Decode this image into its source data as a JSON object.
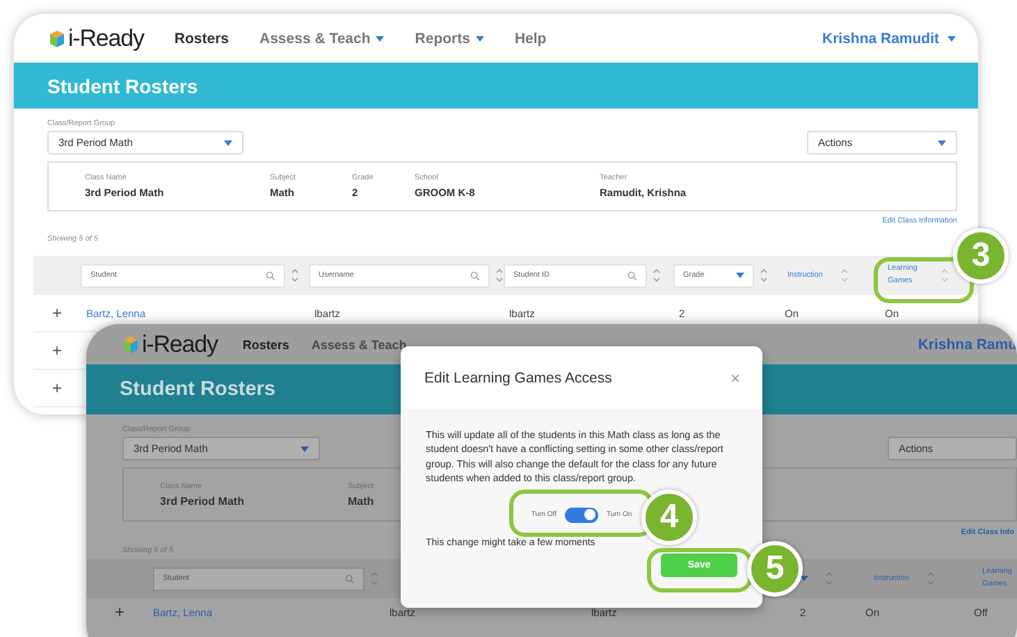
{
  "back": {
    "logo": "i-Ready",
    "nav": [
      {
        "label": "Rosters",
        "selected": true,
        "dropdown": false
      },
      {
        "label": "Assess & Teach",
        "selected": false,
        "dropdown": true
      },
      {
        "label": "Reports",
        "selected": false,
        "dropdown": true
      },
      {
        "label": "Help",
        "selected": false,
        "dropdown": false
      }
    ],
    "user": "Krishna Ramudit",
    "title": "Student Rosters",
    "group_label": "Class/Report Group",
    "group_value": "3rd Period Math",
    "actions": "Actions",
    "class_info": [
      {
        "label": "Class Name",
        "value": "3rd Period Math"
      },
      {
        "label": "Subject",
        "value": "Math"
      },
      {
        "label": "Grade",
        "value": "2"
      },
      {
        "label": "School",
        "value": "GROOM K-8"
      },
      {
        "label": "Teacher",
        "value": "Ramudit, Krishna"
      }
    ],
    "edit_link": "Edit Class Information",
    "showing": "Showing 5 of 5",
    "columns": [
      {
        "kind": "search",
        "placeholder": "Student"
      },
      {
        "kind": "search",
        "placeholder": "Username"
      },
      {
        "kind": "search",
        "placeholder": "Student ID"
      },
      {
        "kind": "select",
        "placeholder": "Grade"
      },
      {
        "kind": "sort",
        "label": "Instruction"
      },
      {
        "kind": "sort",
        "label": "Learning Games"
      }
    ],
    "rows": [
      {
        "expand": "+",
        "cells": [
          "Bartz, Lenna",
          "lbartz",
          "lbartz",
          "2",
          "On",
          "On"
        ]
      },
      {
        "expand": "+",
        "cells": []
      },
      {
        "expand": "+",
        "cells": []
      }
    ]
  },
  "front": {
    "logo": "i-Ready",
    "nav": [
      {
        "label": "Rosters",
        "selected": true
      },
      {
        "label": "Assess & Teach",
        "selected": false
      }
    ],
    "user": "Krishna Ramu",
    "title": "Student Rosters",
    "group_label": "Class/Report Group",
    "group_value": "3rd Period Math",
    "actions": "Actions",
    "class_info": [
      {
        "label": "Class Name",
        "value": "3rd Period Math"
      },
      {
        "label": "Subject",
        "value": "Math"
      }
    ],
    "edit_link": "Edit Class Info",
    "showing": "Showing 5 of 5",
    "student_placeholder": "Student",
    "instruction": "Instruction",
    "learning_games": "Learning Games",
    "row": {
      "expand": "+",
      "cells": [
        "Bartz, Lenna",
        "lbartz",
        "lbartz",
        "2",
        "On",
        "Off"
      ]
    }
  },
  "modal": {
    "title": "Edit Learning Games Access",
    "close": "×",
    "body": "This will update all of the students in this Math class as long as the student doesn't have a conflicting setting in some other class/report group. This will also change the default for the class for any future students when added to this class/report group.",
    "toggle": {
      "off_label": "Turn Off",
      "on_label": "Turn On",
      "on": true
    },
    "note": "This change might take a few moments",
    "save": "Save"
  },
  "callouts": [
    {
      "number": "3"
    },
    {
      "number": "4"
    },
    {
      "number": "5"
    }
  ]
}
